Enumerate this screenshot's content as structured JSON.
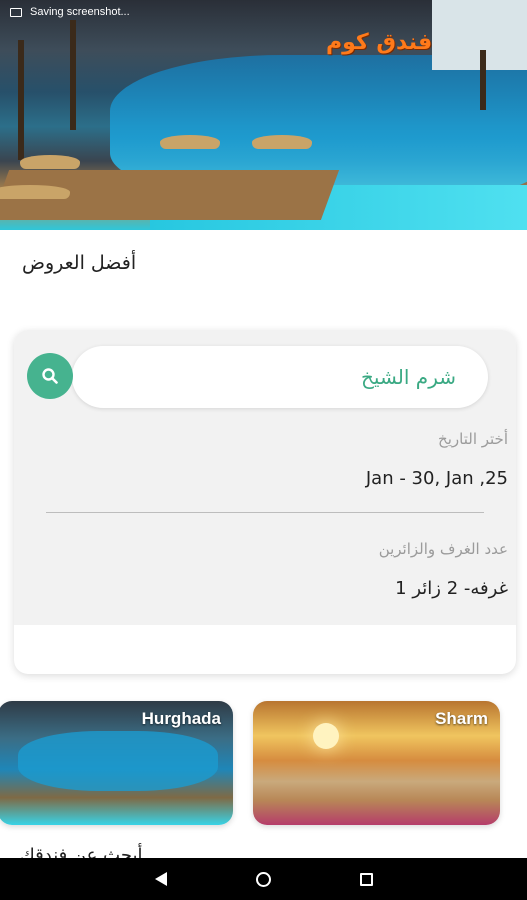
{
  "status_bar": {
    "notification": "Saving screenshot..."
  },
  "hero": {
    "logo_text": "فندق كوم"
  },
  "offers": {
    "title": "أفضل العروض"
  },
  "search": {
    "destination_value": "شرم الشيخ",
    "date_label": "أختر التاريخ",
    "date_value": "Jan - 30, Jan ,25",
    "guests_label": "عدد الغرف والزائرين",
    "guests_value": "1 غرفه- 2 زائر",
    "button_icon": "search-icon"
  },
  "destinations": [
    {
      "name": "Hurghada"
    },
    {
      "name": "Sharm"
    }
  ],
  "section_partial": {
    "title": "أبحث عن فندقك"
  },
  "colors": {
    "accent": "#46b38f",
    "accent_text": "#3aa983",
    "logo": "#ff7a1a"
  },
  "navigation": {
    "back_icon": "back-icon",
    "home_icon": "home-icon",
    "recent_icon": "recent-apps-icon"
  }
}
